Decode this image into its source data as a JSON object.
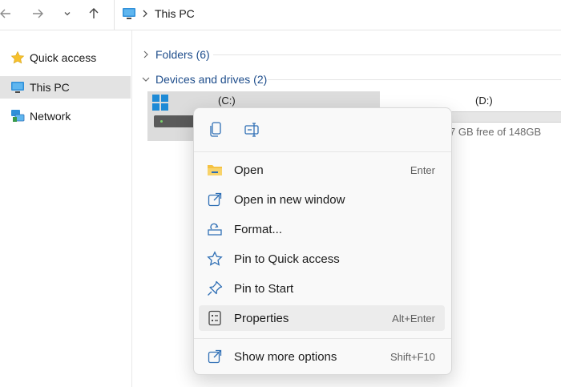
{
  "address_bar": {
    "location": "This PC"
  },
  "sidebar": {
    "items": [
      {
        "label": "Quick access",
        "icon": "star-icon"
      },
      {
        "label": "This PC",
        "icon": "monitor-icon",
        "selected": true
      },
      {
        "label": "Network",
        "icon": "network-icon"
      }
    ]
  },
  "main": {
    "groups": [
      {
        "label": "Folders (6)",
        "expanded": false
      },
      {
        "label": "Devices and drives (2)",
        "expanded": true
      }
    ],
    "drives": [
      {
        "label": "(C:)"
      },
      {
        "label": "(D:)",
        "free_text": "7 GB free of 148GB"
      }
    ]
  },
  "context_menu": {
    "toolbar": [
      {
        "icon": "copy-icon"
      },
      {
        "icon": "rename-icon"
      }
    ],
    "items": [
      {
        "label": "Open",
        "shortcut": "Enter",
        "icon": "folder-icon"
      },
      {
        "label": "Open in new window",
        "shortcut": "",
        "icon": "open-new-window-icon"
      },
      {
        "label": "Format...",
        "shortcut": "",
        "icon": "format-icon"
      },
      {
        "label": "Pin to Quick access",
        "shortcut": "",
        "icon": "star-outline-icon"
      },
      {
        "label": "Pin to Start",
        "shortcut": "",
        "icon": "pin-icon"
      },
      {
        "label": "Properties",
        "shortcut": "Alt+Enter",
        "icon": "properties-icon",
        "highlighted": true
      },
      {
        "label": "Show more options",
        "shortcut": "Shift+F10",
        "icon": "more-options-icon"
      }
    ]
  },
  "colors": {
    "accent": "#1f4e8c",
    "selection": "#e3e3e3",
    "menu_bg": "#f9f9f9",
    "icon_blue": "#2f6fb5",
    "folder_yellow": "#f5c242"
  }
}
